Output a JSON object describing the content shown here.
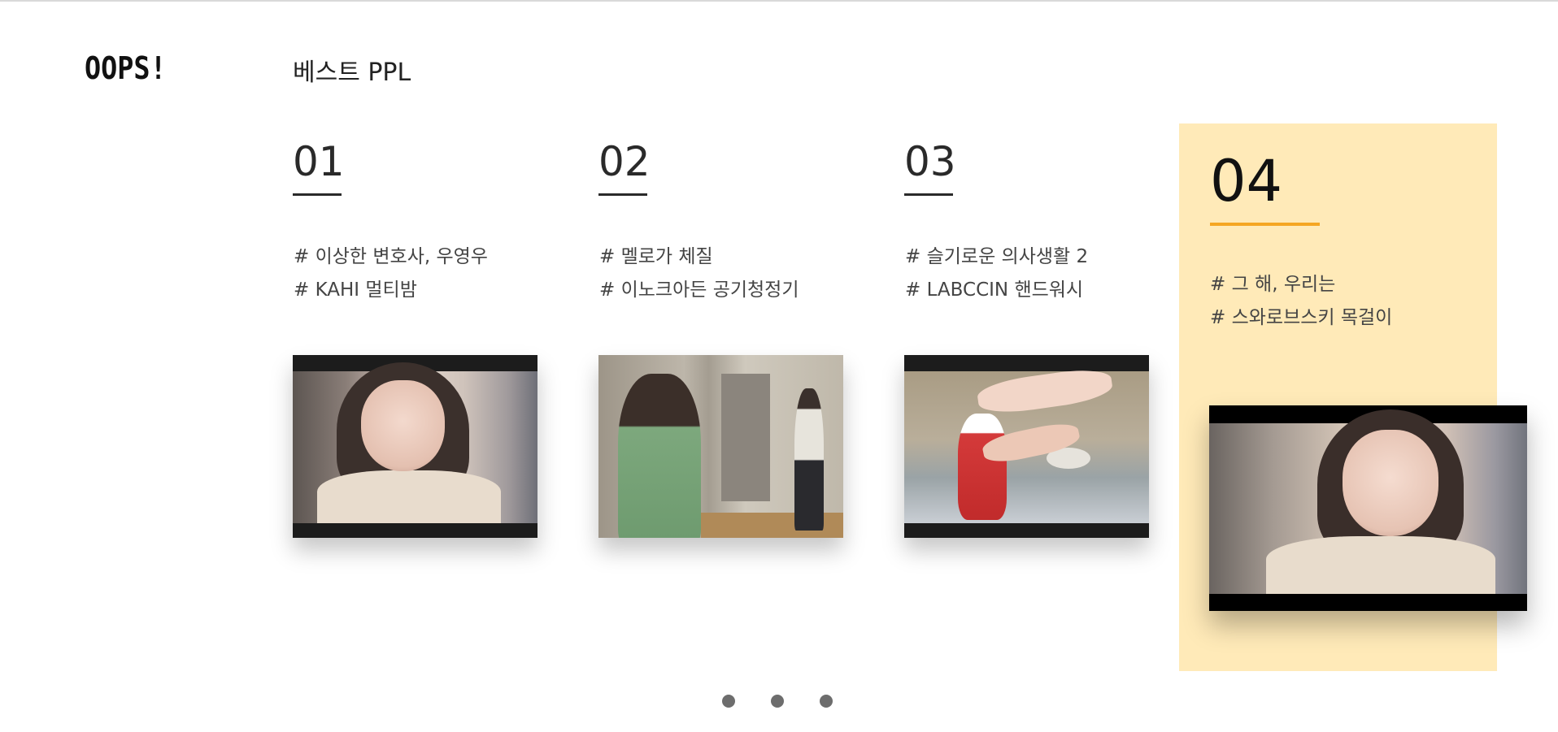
{
  "brand": {
    "logo": "OOPS!"
  },
  "section": {
    "title": "베스트 PPL"
  },
  "cards": [
    {
      "number": "01",
      "tag1": "# 이상한 변호사, 우영우",
      "tag2": "# KAHI 멀티밤",
      "image": "drama-still-woman-sweater"
    },
    {
      "number": "02",
      "tag1": "# 멜로가 체질",
      "tag2": "# 이노크아든 공기청정기",
      "image": "drama-still-living-room"
    },
    {
      "number": "03",
      "tag1": "# 슬기로운 의사생활 2",
      "tag2": "# LABCCIN 핸드워시",
      "image": "drama-still-hand-wash"
    },
    {
      "number": "04",
      "tag1": "# 그 해, 우리는",
      "tag2": "# 스와로브스키 목걸이",
      "image": "drama-still-woman-necklace",
      "active": true
    }
  ],
  "pagination": {
    "pages": 3
  },
  "colors": {
    "active_bg": "#ffeab8",
    "active_underline": "#f5a623",
    "text": "#222222"
  }
}
